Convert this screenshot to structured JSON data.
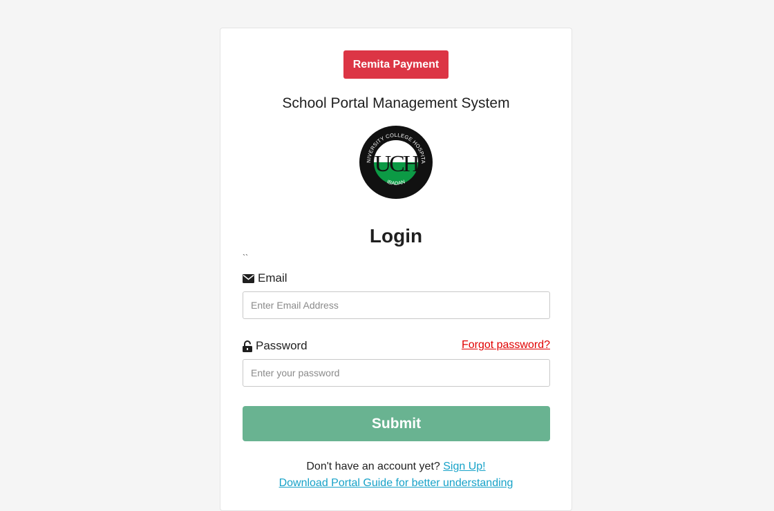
{
  "header": {
    "remita_label": "Remita Payment",
    "system_title": "School Portal Management System"
  },
  "logo": {
    "top_text": "UNIVERSITY COLLEGE HOSPITAL",
    "bottom_text": "IBADAN",
    "monogram": "UCH"
  },
  "form": {
    "heading": "Login",
    "stray_mark": "``",
    "email_label": "Email",
    "email_placeholder": "Enter Email Address",
    "email_value": "",
    "password_label": "Password",
    "password_placeholder": "Enter your password",
    "password_value": "",
    "forgot_label": "Forgot password?",
    "submit_label": "Submit"
  },
  "footer": {
    "signup_prompt": "Don't have an account yet?",
    "signup_link": "Sign Up!",
    "guide_link": "Download Portal Guide for better understanding"
  },
  "icons": {
    "email": "envelope-icon",
    "password": "unlock-icon"
  },
  "colors": {
    "remita": "#dc3545",
    "submit": "#69b391",
    "forgot_link": "#e00000",
    "link": "#17a2c8",
    "logo_green": "#0c9a45"
  }
}
